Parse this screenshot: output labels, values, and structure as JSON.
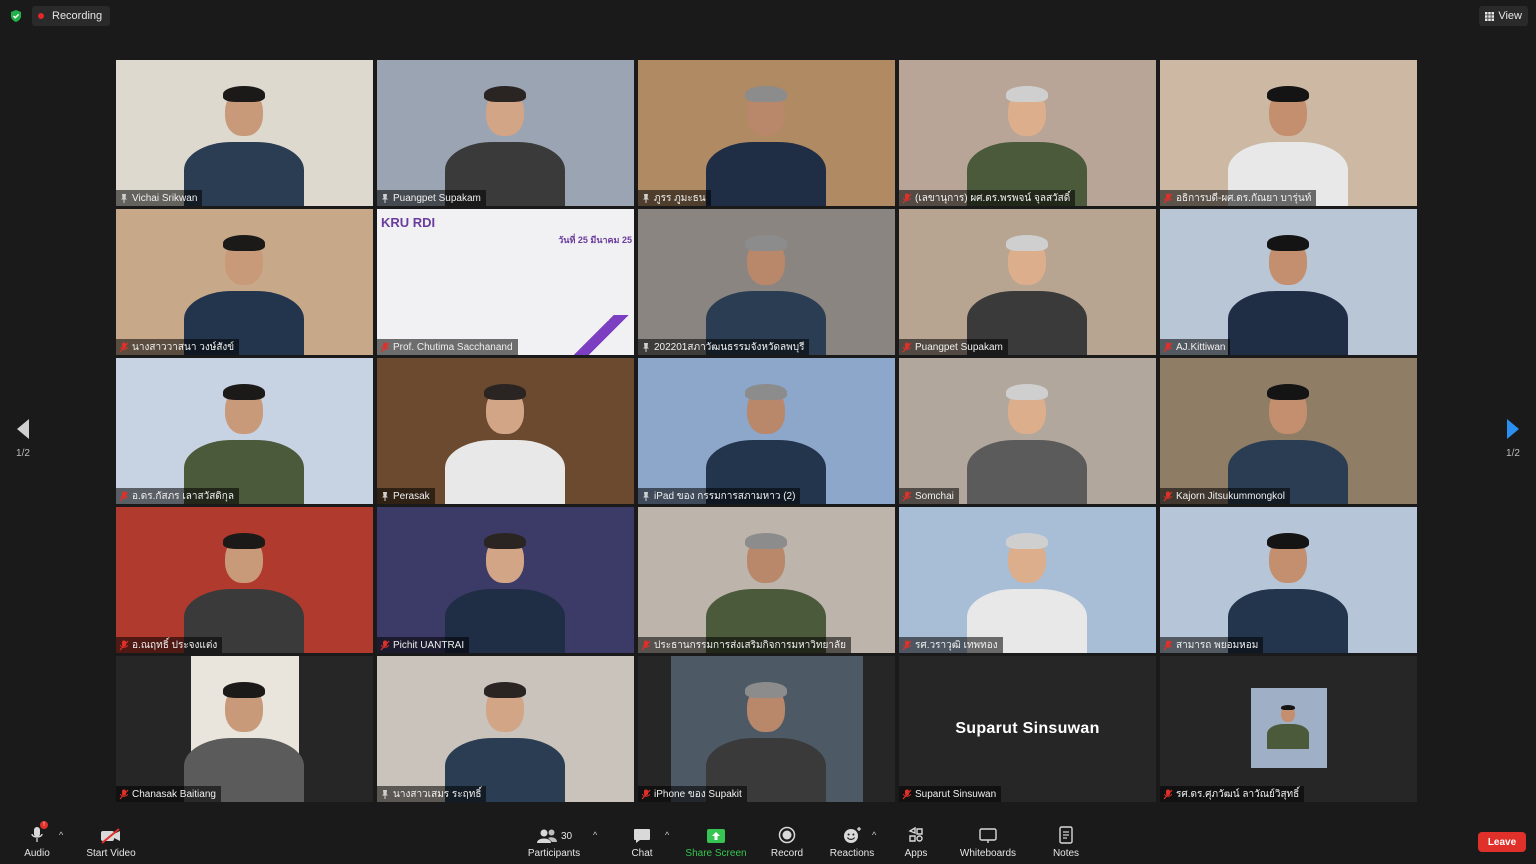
{
  "top": {
    "recording_label": "Recording",
    "view_label": "View"
  },
  "pager": {
    "left_label": "1/2",
    "right_label": "1/2"
  },
  "tiles": [
    {
      "name": "Vichai  Srikwan",
      "mic_muted": false,
      "active": true,
      "bg": "#ded9cf"
    },
    {
      "name": "Puangpet Supakam",
      "mic_muted": false,
      "bg": "#9aa4b3"
    },
    {
      "name": "ภูรร ภูมะธน",
      "mic_muted": false,
      "bg": "#b08a62"
    },
    {
      "name": "(เลขานุการ) ผศ.ดร.พรพจน์ จุลสวัสดิ์",
      "mic_muted": true,
      "bg": "#b8a597"
    },
    {
      "name": "อธิการบดี-ผศ.ดร.กัณยา บารุ่นท์",
      "mic_muted": true,
      "bg": "#cdb8a4"
    },
    {
      "name": "นางสาววาสนา วงษ์สังข์",
      "mic_muted": true,
      "bg": "#c7a98a"
    },
    {
      "name": "Prof. Chutima Sacchanand",
      "mic_muted": true,
      "bg": "#f1f1f3",
      "slide": "KRU RDI",
      "slide_date": "วันที่ 25 มีนาคม 25"
    },
    {
      "name": "202201สภาวัฒนธรรมจังหวัดลพบุรี",
      "mic_muted": false,
      "bg": "#8a8580"
    },
    {
      "name": "Puangpet Supakam",
      "mic_muted": true,
      "bg": "#b7a592"
    },
    {
      "name": "AJ.Kittiwan",
      "mic_muted": true,
      "bg": "#b9c6d6"
    },
    {
      "name": "อ.ดร.กัสภร เลาสวัสดิกุล",
      "mic_muted": true,
      "bg": "#c7d3e2"
    },
    {
      "name": "Perasak",
      "mic_muted": false,
      "bg": "#6b4a30"
    },
    {
      "name": "iPad ของ กรรมการสภามหาว (2)",
      "mic_muted": false,
      "bg": "#8ca7c9"
    },
    {
      "name": "Somchai",
      "mic_muted": true,
      "bg": "#b2a79c"
    },
    {
      "name": "Kajorn Jitsukummongkol",
      "mic_muted": true,
      "bg": "#8f7d66"
    },
    {
      "name": "อ.ณฤทธิ์ ประจงแต่ง",
      "mic_muted": true,
      "bg": "#b03a2e"
    },
    {
      "name": "Pichit UANTRAI",
      "mic_muted": true,
      "bg": "#3c3a66"
    },
    {
      "name": "ประธานกรรมการส่งเสริมกิจการมหาวิทยาลัย",
      "mic_muted": true,
      "bg": "#bdb4ab"
    },
    {
      "name": "รศ.วราวุฒิ เทพทอง",
      "mic_muted": true,
      "bg": "#a8bdd6"
    },
    {
      "name": "สามารถ พยอมหอม",
      "mic_muted": true,
      "bg": "#b7c5d8"
    },
    {
      "name": "Chanasak Baitiang",
      "mic_muted": true,
      "bg": "#262626"
    },
    {
      "name": "นางสาวเสมร ระฤทธิ์",
      "mic_muted": false,
      "bg": "#c9c3bb"
    },
    {
      "name": "iPhone ของ Supakit",
      "mic_muted": true,
      "bg": "#262626"
    },
    {
      "name": "Suparut  Sinsuwan",
      "mic_muted": true,
      "bg": "#262626",
      "center_name": "Suparut  Sinsuwan"
    },
    {
      "name": "รศ.ดร.ศุภวัฒน์ ลาวัณย์วิสุทธิ์",
      "mic_muted": true,
      "bg": "#262626"
    }
  ],
  "toolbar": {
    "audio": "Audio",
    "start_video": "Start Video",
    "participants": "Participants",
    "participants_count": "30",
    "chat": "Chat",
    "share_screen": "Share Screen",
    "record": "Record",
    "reactions": "Reactions",
    "apps": "Apps",
    "whiteboards": "Whiteboards",
    "notes": "Notes",
    "leave": "Leave"
  },
  "colors": {
    "accent_green": "#36c552",
    "leave_red": "#e0302a",
    "active_speaker": "#c8d400"
  }
}
